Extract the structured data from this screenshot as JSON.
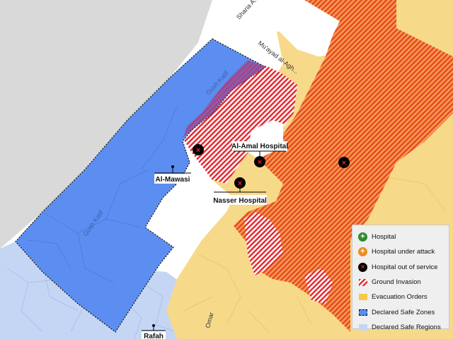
{
  "colors": {
    "background": "#d9d9d9",
    "land": "#ffffff",
    "evacuation": "#f7d98a",
    "ground_invasion": "#e8232b",
    "combined_zone": "#f07a3a",
    "safe_zone": "#5b8ef0",
    "safe_region": "#c5d6f5",
    "hospital": "#2e8b2e",
    "hospital_attack": "#f08c1e",
    "hospital_out": "#000000"
  },
  "labels": {
    "al_amal": "Al-Amal Hospital",
    "nasser": "Nasser Hospital",
    "al_mawasi": "Al-Mawasi",
    "rafah": "Rafah"
  },
  "roads": {
    "sharia": "Sharia A...",
    "muayad": "Mu'ayad al-Agh...",
    "omar": "Omar",
    "gush_katif": "Gush Katif",
    "gush_katif_north": "Gush Katif"
  },
  "legend": {
    "items": [
      {
        "label": "Hospital",
        "icon": "plus-icon"
      },
      {
        "label": "Hospital under attack",
        "icon": "plus-icon"
      },
      {
        "label": "Hospital out of service",
        "icon": "x-icon"
      },
      {
        "label": "Ground Invasion",
        "icon": "hatch-swatch"
      },
      {
        "label": "Evacuation Orders",
        "icon": "yellow-swatch"
      },
      {
        "label": "Declared Safe Zones",
        "icon": "blue-dashed-swatch"
      },
      {
        "label": "Declared Safe Regions",
        "icon": "light-blue-swatch"
      }
    ]
  }
}
